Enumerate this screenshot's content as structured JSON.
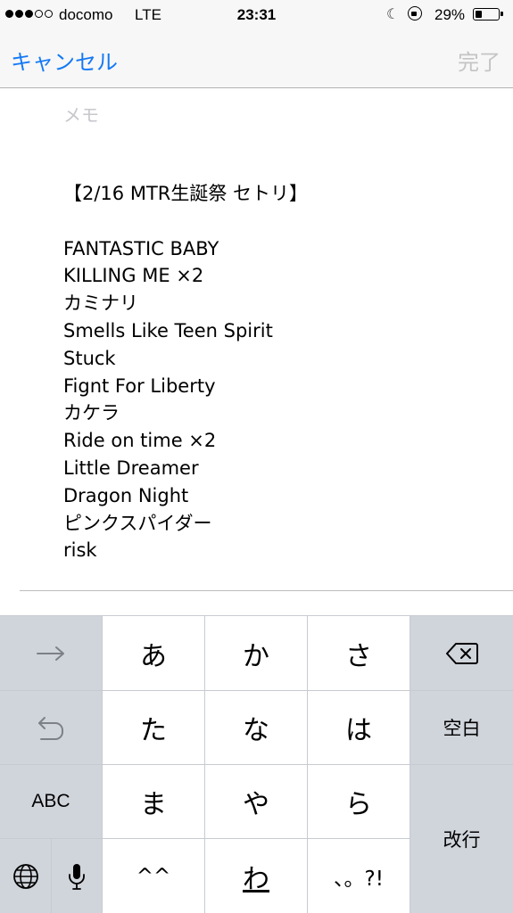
{
  "status_bar": {
    "carrier": "docomo",
    "network": "LTE",
    "time": "23:31",
    "battery_percent": "29%",
    "battery_level": 0.29,
    "signal_strength": 3,
    "signal_max": 5
  },
  "nav": {
    "cancel_label": "キャンセル",
    "done_label": "完了"
  },
  "editor": {
    "placeholder": "メモ",
    "title": "【2/16 MTR生誕祭 セトリ】",
    "songs": [
      "FANTASTIC BABY",
      "KILLING ME ×2",
      "カミナリ",
      "Smells Like Teen Spirit",
      "Stuck",
      "Fignt For Liberty",
      "カケラ",
      "Ride on time ×2",
      "Little Dreamer",
      "Dragon Night",
      "ピンクスパイダー",
      "risk"
    ]
  },
  "keyboard": {
    "row1": {
      "arrow_icon": "arrow-right-icon",
      "k1": "あ",
      "k2": "か",
      "k3": "さ",
      "delete_icon": "backspace-icon"
    },
    "row2": {
      "undo_icon": "undo-icon",
      "k1": "た",
      "k2": "な",
      "k3": "は",
      "space": "空白"
    },
    "row3": {
      "abc": "ABC",
      "k1": "ま",
      "k2": "や",
      "k3": "ら",
      "return": "改行"
    },
    "row4": {
      "globe_icon": "globe-icon",
      "mic_icon": "microphone-icon",
      "k1": "^^",
      "k2": "わ",
      "k3": "、。?!"
    }
  },
  "colors": {
    "accent": "#1479f5",
    "disabled": "#c4c4c4",
    "keyboard_bg": "#c7cbd1",
    "func_key": "#d0d4db"
  }
}
